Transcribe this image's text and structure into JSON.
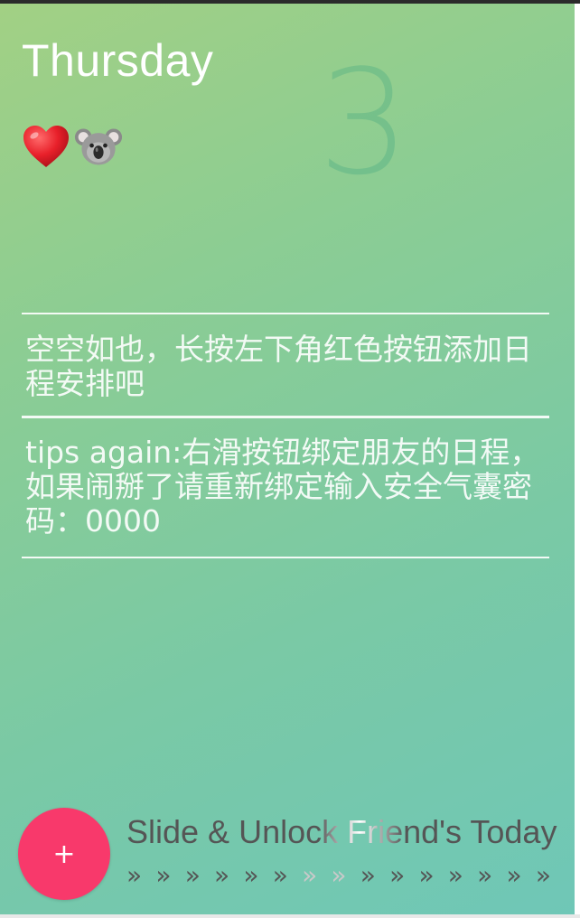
{
  "header": {
    "weekday": "Thursday",
    "date_number": "3"
  },
  "emoji": [
    {
      "char": "❤️",
      "icon": "red-heart-icon"
    },
    {
      "char": "🐨",
      "icon": "koala-icon"
    }
  ],
  "notes": [
    "空空如也，长按左下角红色按钮添加日程安排吧",
    "tips again:右滑按钮绑定朋友的日程，如果闹掰了请重新绑定输入安全气囊密码：0000"
  ],
  "footer": {
    "add_button_label": "+",
    "slide_text": "Slide & Unlock Friend's Today",
    "arrow_glyph": "»"
  },
  "colors": {
    "add_button": "#f8396b",
    "gradient_start": "#a2d084",
    "gradient_end": "#6fc7b7"
  }
}
